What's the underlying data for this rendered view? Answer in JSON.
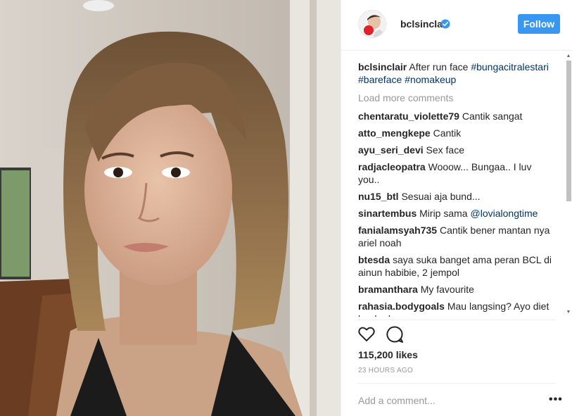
{
  "post": {
    "username": "bclsinclair",
    "follow_label": "Follow",
    "photo_alt": "selfie photo"
  },
  "caption": {
    "username": "bclsinclair",
    "text": "After run face",
    "tags": [
      "#bungacitralestari",
      "#bareface",
      "#nomakeup"
    ]
  },
  "load_more": "Load more comments",
  "comments": [
    {
      "user": "chentaratu_violette79",
      "text": "Cantik sangat"
    },
    {
      "user": "atto_mengkepe",
      "text": "Cantik"
    },
    {
      "user": "ayu_seri_devi",
      "text": "Sex face"
    },
    {
      "user": "radjacleopatra",
      "text": "Wooow... Bungaa.. I luv you.."
    },
    {
      "user": "nu15_btl",
      "text": "Sesuai aja bund..."
    },
    {
      "user": "sinartembus",
      "text": "Mirip sama ",
      "mention": "@lovialongtime"
    },
    {
      "user": "fanialamsyah735",
      "text": "Cantik bener mantan nya ariel noah"
    },
    {
      "user": "btesda",
      "text": "saya suka banget ama peran BCL di ainun habibie, 2 jempol"
    },
    {
      "user": "bramanthara",
      "text": "My favourite"
    },
    {
      "user": "rahasia.bodygoals",
      "text": "Mau langsing? Ayo diet buah plum"
    }
  ],
  "likes": "115,200 likes",
  "time": "23 HOURS AGO",
  "comment_placeholder": "Add a comment...",
  "more_label": "•••",
  "colors": {
    "accent": "#3897f0",
    "hashtag": "#003569",
    "muted": "#999999"
  },
  "icons": [
    "verified-badge-icon",
    "heart-icon",
    "comment-icon",
    "more-options-icon"
  ]
}
